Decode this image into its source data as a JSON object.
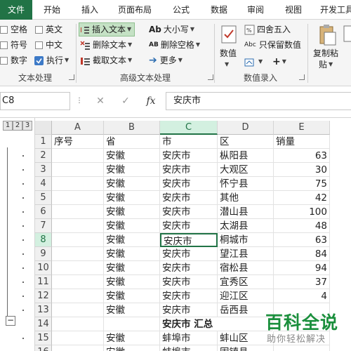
{
  "tabs": [
    "文件",
    "开始",
    "插入",
    "页面布局",
    "公式",
    "数据",
    "审阅",
    "视图",
    "开发工具"
  ],
  "ribbon": {
    "text_group": {
      "items": [
        "空格",
        "英文",
        "符号",
        "中文",
        "数字",
        "执行"
      ],
      "label": "文本处理"
    },
    "adv_group": {
      "items": [
        "插入文本",
        "删除文本",
        "截取文本",
        "大小写",
        "删除空格",
        "更多"
      ],
      "label": "高级文本处理"
    },
    "num_group": {
      "items": [
        "数值",
        "四舍五入",
        "只保留数值"
      ],
      "label": "数值录入"
    },
    "right_group": {
      "items": [
        "复制粘",
        "贴"
      ]
    }
  },
  "formula_bar": {
    "name_box": "C8",
    "value": "安庆市",
    "fx": "fx"
  },
  "outline_levels": [
    "1",
    "2",
    "3"
  ],
  "columns": [
    "A",
    "B",
    "C",
    "D",
    "E"
  ],
  "rows": [
    {
      "n": "1",
      "a": "序号",
      "b": "省",
      "c": "市",
      "d": "区",
      "e": "销量"
    },
    {
      "n": "2",
      "a": "",
      "b": "安徽",
      "c": "安庆市",
      "d": "枞阳县",
      "e": "63"
    },
    {
      "n": "3",
      "a": "",
      "b": "安徽",
      "c": "安庆市",
      "d": "大观区",
      "e": "30"
    },
    {
      "n": "4",
      "a": "",
      "b": "安徽",
      "c": "安庆市",
      "d": "怀宁县",
      "e": "75"
    },
    {
      "n": "5",
      "a": "",
      "b": "安徽",
      "c": "安庆市",
      "d": "其他",
      "e": "42"
    },
    {
      "n": "6",
      "a": "",
      "b": "安徽",
      "c": "安庆市",
      "d": "潜山县",
      "e": "100"
    },
    {
      "n": "7",
      "a": "",
      "b": "安徽",
      "c": "安庆市",
      "d": "太湖县",
      "e": "48"
    },
    {
      "n": "8",
      "a": "",
      "b": "安徽",
      "c": "安庆市",
      "d": "桐城市",
      "e": "63"
    },
    {
      "n": "9",
      "a": "",
      "b": "安徽",
      "c": "安庆市",
      "d": "望江县",
      "e": "84"
    },
    {
      "n": "10",
      "a": "",
      "b": "安徽",
      "c": "安庆市",
      "d": "宿松县",
      "e": "94"
    },
    {
      "n": "11",
      "a": "",
      "b": "安徽",
      "c": "安庆市",
      "d": "宜秀区",
      "e": "37"
    },
    {
      "n": "12",
      "a": "",
      "b": "安徽",
      "c": "安庆市",
      "d": "迎江区",
      "e": "4"
    },
    {
      "n": "13",
      "a": "",
      "b": "安徽",
      "c": "安庆市",
      "d": "岳西县",
      "e": ""
    },
    {
      "n": "14",
      "a": "",
      "b": "",
      "c": "安庆市 汇总",
      "d": "",
      "e": ""
    },
    {
      "n": "15",
      "a": "",
      "b": "安徽",
      "c": "蚌埠市",
      "d": "蚌山区",
      "e": ""
    },
    {
      "n": "16",
      "a": "",
      "b": "安徽",
      "c": "蚌埠市",
      "d": "固镇县",
      "e": ""
    }
  ],
  "watermark": {
    "big": "百科全说",
    "small": "助你轻松解决"
  },
  "colors": {
    "excel_green": "#217346",
    "ribbon_bg": "#f5f5f5",
    "watermark_green": "#1a8f3c"
  }
}
